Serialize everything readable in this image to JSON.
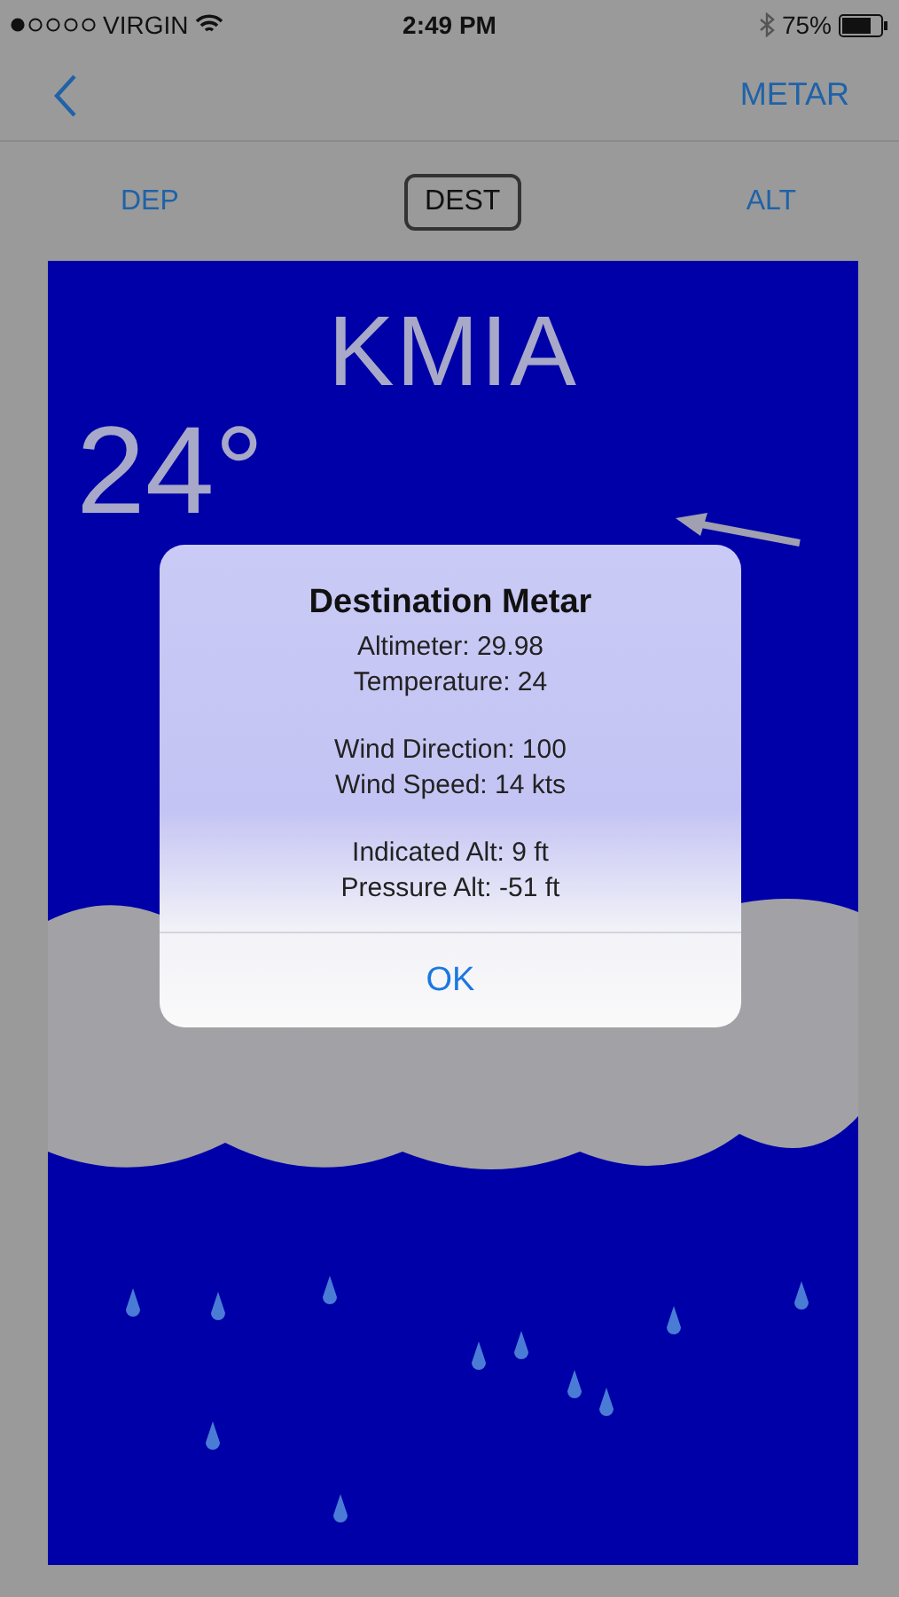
{
  "status_bar": {
    "carrier": "VIRGIN",
    "time": "2:49 PM",
    "battery": "75%"
  },
  "nav": {
    "action": "METAR"
  },
  "segments": [
    {
      "label": "DEP",
      "selected": false
    },
    {
      "label": "DEST",
      "selected": true
    },
    {
      "label": "ALT",
      "selected": false
    }
  ],
  "weather": {
    "station": "KMIA",
    "temperature": "24°"
  },
  "alert": {
    "title": "Destination Metar",
    "groups": [
      [
        "Altimeter: 29.98",
        "Temperature: 24"
      ],
      [
        "Wind Direction: 100",
        "Wind Speed: 14 kts"
      ],
      [
        "Indicated Alt: 9 ft",
        "Pressure Alt: -51 ft"
      ]
    ],
    "button": "OK"
  }
}
